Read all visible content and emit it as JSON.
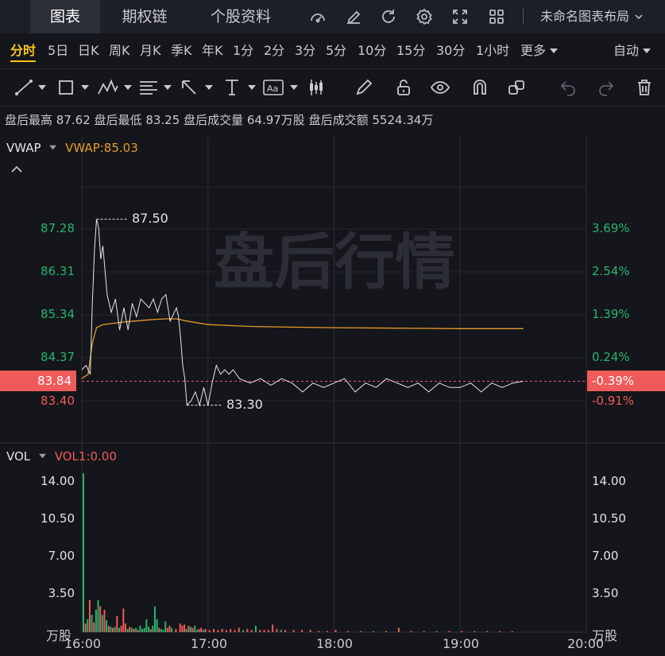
{
  "tabs": [
    {
      "label": "图表",
      "active": true
    },
    {
      "label": "期权链",
      "active": false
    },
    {
      "label": "个股资料",
      "active": false
    }
  ],
  "top_icons": [
    "gauge-icon",
    "edit-icon",
    "refresh-icon",
    "settings-icon",
    "fullscreen-icon",
    "grid-icon"
  ],
  "layout_name": "未命名图表布局",
  "periods": [
    "分时",
    "5日",
    "日K",
    "周K",
    "月K",
    "季K",
    "年K",
    "1分",
    "2分",
    "3分",
    "5分",
    "10分",
    "15分",
    "30分",
    "1小时",
    "更多"
  ],
  "active_period": "分时",
  "auto_label": "自动",
  "tools": [
    "trendline-tool",
    "rectangle-tool",
    "pattern-tool",
    "fibonacci-tool",
    "arrow-tool",
    "measure-tool",
    "text-tool",
    "candle-tool",
    "pencil-icon",
    "unlock-icon",
    "eye-icon",
    "magnet-icon",
    "link-icon",
    "undo-icon",
    "redo-icon",
    "trash-icon"
  ],
  "info": {
    "high_label": "盘后最高",
    "high": "87.62",
    "low_label": "盘后最低",
    "low": "83.25",
    "volume_label": "盘后成交量",
    "volume": "64.97万股",
    "amount_label": "盘后成交额",
    "amount": "5524.34万"
  },
  "vwap": {
    "name": "VWAP",
    "value_text": "VWAP:85.03"
  },
  "watermark": "盘后行情",
  "price_axis_left": [
    "87.28",
    "86.31",
    "85.34",
    "84.37",
    "83.40"
  ],
  "price_axis_right": [
    "3.69%",
    "2.54%",
    "1.39%",
    "0.24%",
    "-0.91%"
  ],
  "current_price": "83.84",
  "current_pct": "-0.39%",
  "high_marker": "87.50",
  "low_marker": "83.30",
  "vol": {
    "name": "VOL",
    "value_text": "VOL1:0.00",
    "unit": "万股"
  },
  "vol_axis": [
    "14.00",
    "10.50",
    "7.00",
    "3.50"
  ],
  "time_labels": [
    "16:00",
    "17:00",
    "18:00",
    "19:00",
    "20:00"
  ],
  "colors": {
    "up": "#ef5a5a",
    "down": "#29b36e",
    "vwap": "#e59b2a",
    "price_line": "#e6e6e6",
    "accent": "#f5c518"
  },
  "chart_data": {
    "type": "line",
    "series": [
      {
        "name": "VWAP",
        "x": [
          "16:00",
          "16:03",
          "16:05",
          "16:07",
          "16:10",
          "16:15",
          "16:20",
          "16:25",
          "16:30",
          "16:35",
          "16:40",
          "16:45",
          "16:50",
          "17:00",
          "17:10",
          "17:20",
          "17:30",
          "17:45",
          "18:00",
          "18:30",
          "19:00",
          "19:15",
          "19:30"
        ],
        "values": [
          83.9,
          84.0,
          84.7,
          85.05,
          85.12,
          85.15,
          85.18,
          85.2,
          85.22,
          85.24,
          85.25,
          85.25,
          85.2,
          85.12,
          85.1,
          85.08,
          85.07,
          85.06,
          85.05,
          85.04,
          85.03,
          85.03,
          85.03
        ]
      },
      {
        "name": "Price",
        "x": [
          "16:00",
          "16:02",
          "16:04",
          "16:05",
          "16:06",
          "16:07",
          "16:08",
          "16:09",
          "16:10",
          "16:12",
          "16:14",
          "16:16",
          "16:18",
          "16:20",
          "16:22",
          "16:24",
          "16:26",
          "16:28",
          "16:30",
          "16:32",
          "16:34",
          "16:36",
          "16:38",
          "16:40",
          "16:42",
          "16:44",
          "16:45",
          "16:46",
          "16:47",
          "16:48",
          "16:49",
          "16:50",
          "16:52",
          "16:54",
          "16:56",
          "16:58",
          "17:00",
          "17:02",
          "17:04",
          "17:06",
          "17:08",
          "17:10",
          "17:12",
          "17:15",
          "17:20",
          "17:25",
          "17:30",
          "17:35",
          "17:40",
          "17:45",
          "17:50",
          "17:55",
          "18:00",
          "18:05",
          "18:10",
          "18:15",
          "18:20",
          "18:25",
          "18:30",
          "18:35",
          "18:40",
          "18:45",
          "18:50",
          "18:55",
          "19:00",
          "19:05",
          "19:10",
          "19:15",
          "19:20",
          "19:25",
          "19:30"
        ],
        "values": [
          84.1,
          84.2,
          84.0,
          85.6,
          86.8,
          87.5,
          87.3,
          86.6,
          86.9,
          85.8,
          85.4,
          85.7,
          85.0,
          85.5,
          85.0,
          85.6,
          85.3,
          85.7,
          85.6,
          85.5,
          85.7,
          85.4,
          85.7,
          85.8,
          85.2,
          85.4,
          85.5,
          85.3,
          84.8,
          84.2,
          83.9,
          83.3,
          83.4,
          83.6,
          83.3,
          83.7,
          83.3,
          83.8,
          84.2,
          84.0,
          84.1,
          84.0,
          84.1,
          83.9,
          83.8,
          83.9,
          83.75,
          83.9,
          83.8,
          83.6,
          83.8,
          83.7,
          83.8,
          83.9,
          83.6,
          83.8,
          83.7,
          83.9,
          83.8,
          83.7,
          83.8,
          83.6,
          83.8,
          83.7,
          83.7,
          83.8,
          83.6,
          83.8,
          83.7,
          83.8,
          83.84
        ]
      }
    ],
    "prev_close": 84.17,
    "ylim": [
      83.0,
      88.0
    ],
    "xlim": [
      "16:00",
      "20:00"
    ],
    "volume": {
      "unit": "万股",
      "ylim": [
        0,
        15
      ],
      "bars": [
        {
          "t": "16:00",
          "v": 14.8,
          "c": "down"
        },
        {
          "t": "16:01",
          "v": 0.8,
          "c": "up"
        },
        {
          "t": "16:02",
          "v": 1.2,
          "c": "down"
        },
        {
          "t": "16:03",
          "v": 3.0,
          "c": "up"
        },
        {
          "t": "16:04",
          "v": 1.6,
          "c": "down"
        },
        {
          "t": "16:05",
          "v": 0.9,
          "c": "up"
        },
        {
          "t": "16:06",
          "v": 2.1,
          "c": "down"
        },
        {
          "t": "16:07",
          "v": 3.0,
          "c": "down"
        },
        {
          "t": "16:08",
          "v": 2.4,
          "c": "up"
        },
        {
          "t": "16:09",
          "v": 1.6,
          "c": "down"
        },
        {
          "t": "16:10",
          "v": 2.1,
          "c": "up"
        },
        {
          "t": "16:11",
          "v": 1.1,
          "c": "down"
        },
        {
          "t": "16:12",
          "v": 0.6,
          "c": "up"
        },
        {
          "t": "16:13",
          "v": 0.5,
          "c": "down"
        },
        {
          "t": "16:14",
          "v": 0.4,
          "c": "up"
        },
        {
          "t": "16:15",
          "v": 0.5,
          "c": "down"
        },
        {
          "t": "16:16",
          "v": 1.5,
          "c": "up"
        },
        {
          "t": "16:17",
          "v": 0.4,
          "c": "down"
        },
        {
          "t": "16:18",
          "v": 0.6,
          "c": "up"
        },
        {
          "t": "16:19",
          "v": 2.2,
          "c": "up"
        },
        {
          "t": "16:20",
          "v": 0.8,
          "c": "up"
        },
        {
          "t": "16:21",
          "v": 0.3,
          "c": "down"
        },
        {
          "t": "16:22",
          "v": 0.5,
          "c": "up"
        },
        {
          "t": "16:23",
          "v": 0.4,
          "c": "down"
        },
        {
          "t": "16:24",
          "v": 0.3,
          "c": "up"
        },
        {
          "t": "16:25",
          "v": 0.4,
          "c": "down"
        },
        {
          "t": "16:26",
          "v": 0.2,
          "c": "up"
        },
        {
          "t": "16:27",
          "v": 0.6,
          "c": "down"
        },
        {
          "t": "16:28",
          "v": 0.3,
          "c": "down"
        },
        {
          "t": "16:29",
          "v": 0.4,
          "c": "down"
        },
        {
          "t": "16:30",
          "v": 1.2,
          "c": "down"
        },
        {
          "t": "16:31",
          "v": 0.5,
          "c": "down"
        },
        {
          "t": "16:32",
          "v": 0.3,
          "c": "up"
        },
        {
          "t": "16:33",
          "v": 0.6,
          "c": "down"
        },
        {
          "t": "16:34",
          "v": 2.4,
          "c": "down"
        },
        {
          "t": "16:35",
          "v": 1.2,
          "c": "down"
        },
        {
          "t": "16:36",
          "v": 0.4,
          "c": "up"
        },
        {
          "t": "16:37",
          "v": 0.3,
          "c": "down"
        },
        {
          "t": "16:38",
          "v": 0.2,
          "c": "down"
        },
        {
          "t": "16:39",
          "v": 1.0,
          "c": "down"
        },
        {
          "t": "16:40",
          "v": 0.4,
          "c": "up"
        },
        {
          "t": "16:41",
          "v": 0.6,
          "c": "up"
        },
        {
          "t": "16:42",
          "v": 0.4,
          "c": "down"
        },
        {
          "t": "16:44",
          "v": 0.3,
          "c": "up"
        },
        {
          "t": "16:46",
          "v": 0.8,
          "c": "up"
        },
        {
          "t": "16:47",
          "v": 0.6,
          "c": "up"
        },
        {
          "t": "16:48",
          "v": 0.7,
          "c": "up"
        },
        {
          "t": "16:49",
          "v": 0.3,
          "c": "down"
        },
        {
          "t": "16:50",
          "v": 0.6,
          "c": "up"
        },
        {
          "t": "16:51",
          "v": 0.5,
          "c": "down"
        },
        {
          "t": "16:52",
          "v": 0.4,
          "c": "up"
        },
        {
          "t": "16:53",
          "v": 0.6,
          "c": "down"
        },
        {
          "t": "16:54",
          "v": 0.2,
          "c": "down"
        },
        {
          "t": "16:55",
          "v": 0.3,
          "c": "up"
        },
        {
          "t": "16:56",
          "v": 0.4,
          "c": "up"
        },
        {
          "t": "16:57",
          "v": 0.2,
          "c": "down"
        },
        {
          "t": "16:58",
          "v": 0.3,
          "c": "up"
        },
        {
          "t": "17:00",
          "v": 0.2,
          "c": "up"
        },
        {
          "t": "17:02",
          "v": 0.3,
          "c": "up"
        },
        {
          "t": "17:04",
          "v": 0.2,
          "c": "up"
        },
        {
          "t": "17:06",
          "v": 0.3,
          "c": "up"
        },
        {
          "t": "17:08",
          "v": 0.2,
          "c": "up"
        },
        {
          "t": "17:10",
          "v": 0.3,
          "c": "up"
        },
        {
          "t": "17:12",
          "v": 0.2,
          "c": "up"
        },
        {
          "t": "17:14",
          "v": 0.4,
          "c": "up"
        },
        {
          "t": "17:16",
          "v": 0.2,
          "c": "down"
        },
        {
          "t": "17:18",
          "v": 0.3,
          "c": "up"
        },
        {
          "t": "17:20",
          "v": 0.2,
          "c": "up"
        },
        {
          "t": "17:22",
          "v": 0.6,
          "c": "down"
        },
        {
          "t": "17:24",
          "v": 0.2,
          "c": "up"
        },
        {
          "t": "17:26",
          "v": 0.2,
          "c": "up"
        },
        {
          "t": "17:28",
          "v": 0.2,
          "c": "up"
        },
        {
          "t": "17:30",
          "v": 0.7,
          "c": "up"
        },
        {
          "t": "17:32",
          "v": 0.3,
          "c": "up"
        },
        {
          "t": "17:34",
          "v": 0.2,
          "c": "down"
        },
        {
          "t": "17:36",
          "v": 0.2,
          "c": "up"
        },
        {
          "t": "17:40",
          "v": 0.2,
          "c": "up"
        },
        {
          "t": "17:44",
          "v": 0.2,
          "c": "up"
        },
        {
          "t": "17:48",
          "v": 0.2,
          "c": "up"
        },
        {
          "t": "17:52",
          "v": 0.1,
          "c": "up"
        },
        {
          "t": "17:56",
          "v": 0.1,
          "c": "up"
        },
        {
          "t": "18:00",
          "v": 0.2,
          "c": "up"
        },
        {
          "t": "18:06",
          "v": 0.1,
          "c": "up"
        },
        {
          "t": "18:12",
          "v": 0.1,
          "c": "up"
        },
        {
          "t": "18:18",
          "v": 0.1,
          "c": "down"
        },
        {
          "t": "18:24",
          "v": 0.1,
          "c": "up"
        },
        {
          "t": "18:30",
          "v": 0.4,
          "c": "up"
        },
        {
          "t": "18:36",
          "v": 0.1,
          "c": "up"
        },
        {
          "t": "18:42",
          "v": 0.1,
          "c": "up"
        },
        {
          "t": "18:48",
          "v": 0.1,
          "c": "down"
        },
        {
          "t": "18:54",
          "v": 0.1,
          "c": "up"
        },
        {
          "t": "19:00",
          "v": 0.1,
          "c": "up"
        },
        {
          "t": "19:06",
          "v": 0.1,
          "c": "up"
        },
        {
          "t": "19:12",
          "v": 0.1,
          "c": "up"
        },
        {
          "t": "19:18",
          "v": 0.1,
          "c": "up"
        },
        {
          "t": "19:24",
          "v": 0.1,
          "c": "up"
        }
      ]
    },
    "grid": true
  }
}
